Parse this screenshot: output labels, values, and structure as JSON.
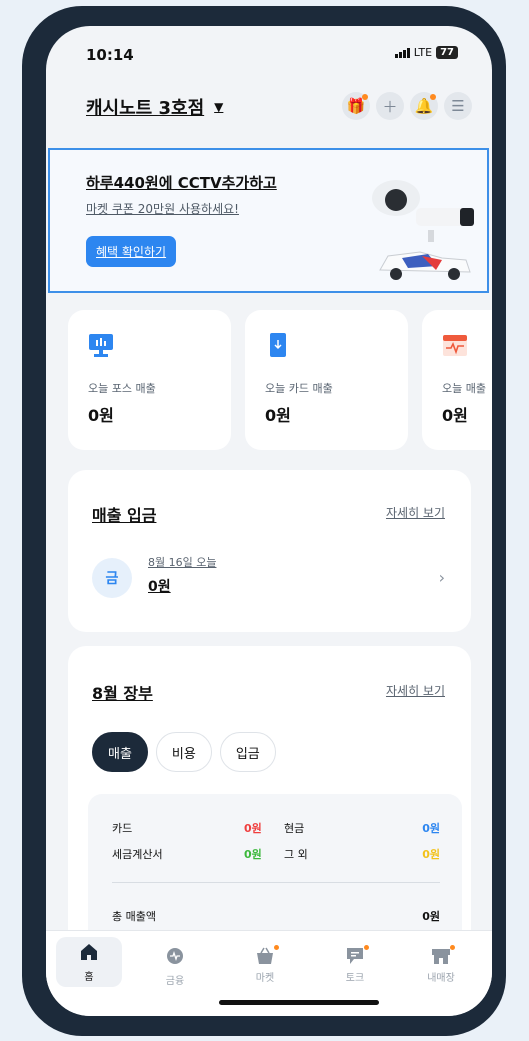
{
  "status": {
    "time": "10:14",
    "network": "LTE",
    "battery": "77"
  },
  "header": {
    "store_name": "캐시노트 3호점"
  },
  "banner": {
    "title": "하루440원에 CCTV추가하고",
    "subtitle": "마켓 쿠폰 20만원 사용하세요!",
    "button": "혜택 확인하기"
  },
  "cards": [
    {
      "label": "오늘 포스 매출",
      "amount": "0원",
      "icon": "pos-monitor-icon",
      "color": "#2d86f0"
    },
    {
      "label": "오늘 카드 매출",
      "amount": "0원",
      "icon": "card-icon",
      "color": "#2d86f0"
    },
    {
      "label": "오늘 매출",
      "amount": "0원",
      "icon": "calendar-icon",
      "color": "#ef5a3c"
    }
  ],
  "deposit": {
    "title": "매출 입금",
    "more": "자세히 보기",
    "day": "금",
    "date": "8월 16일 오늘",
    "amount": "0원"
  },
  "ledger": {
    "title": "8월 장부",
    "more": "자세히 보기",
    "tabs": [
      "매출",
      "비용",
      "입금"
    ],
    "rows": {
      "card_label": "카드",
      "card_value": "0원",
      "cash_label": "현금",
      "cash_value": "0원",
      "tax_label": "세금계산서",
      "tax_value": "0원",
      "other_label": "그 외",
      "other_value": "0원",
      "total_label": "총 매출액",
      "total_value": "0원"
    }
  },
  "nav": [
    {
      "label": "홈",
      "icon": "home-icon"
    },
    {
      "label": "금융",
      "icon": "finance-icon"
    },
    {
      "label": "마켓",
      "icon": "basket-icon"
    },
    {
      "label": "토크",
      "icon": "chat-icon"
    },
    {
      "label": "내매장",
      "icon": "store-icon"
    }
  ]
}
